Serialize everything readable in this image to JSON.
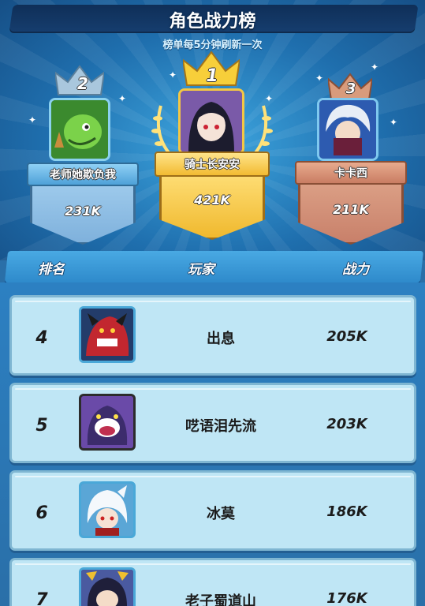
{
  "header": {
    "title": "角色战力榜",
    "subtitle": "榜单每5分钟刷新一次"
  },
  "podium": [
    {
      "rank": "2",
      "name": "老师她欺负我",
      "power": "231K",
      "theme": "silver",
      "avatar_icon": "green-dinosaur-icon"
    },
    {
      "rank": "1",
      "name": "骑士长安安",
      "power": "421K",
      "theme": "gold",
      "avatar_icon": "dark-haired-girl-icon"
    },
    {
      "rank": "3",
      "name": "卡卡西",
      "power": "211K",
      "theme": "bronze",
      "avatar_icon": "white-haired-ninja-icon"
    }
  ],
  "columns": {
    "rank": "排名",
    "player": "玩家",
    "power": "战力"
  },
  "rows": [
    {
      "rank": "4",
      "name": "出息",
      "power": "205K",
      "avatar_icon": "red-dragon-icon"
    },
    {
      "rank": "5",
      "name": "呓语泪先流",
      "power": "203K",
      "avatar_icon": "purple-monster-icon"
    },
    {
      "rank": "6",
      "name": "冰莫",
      "power": "186K",
      "avatar_icon": "white-wolf-girl-icon"
    },
    {
      "rank": "7",
      "name": "老子蜀道山",
      "power": "176K",
      "avatar_icon": "horned-girl-icon"
    }
  ],
  "colors": {
    "gold": "#f5c843",
    "silver": "#8fc2e8",
    "bronze": "#d4927a",
    "row_bg": "#bfe6f5"
  }
}
